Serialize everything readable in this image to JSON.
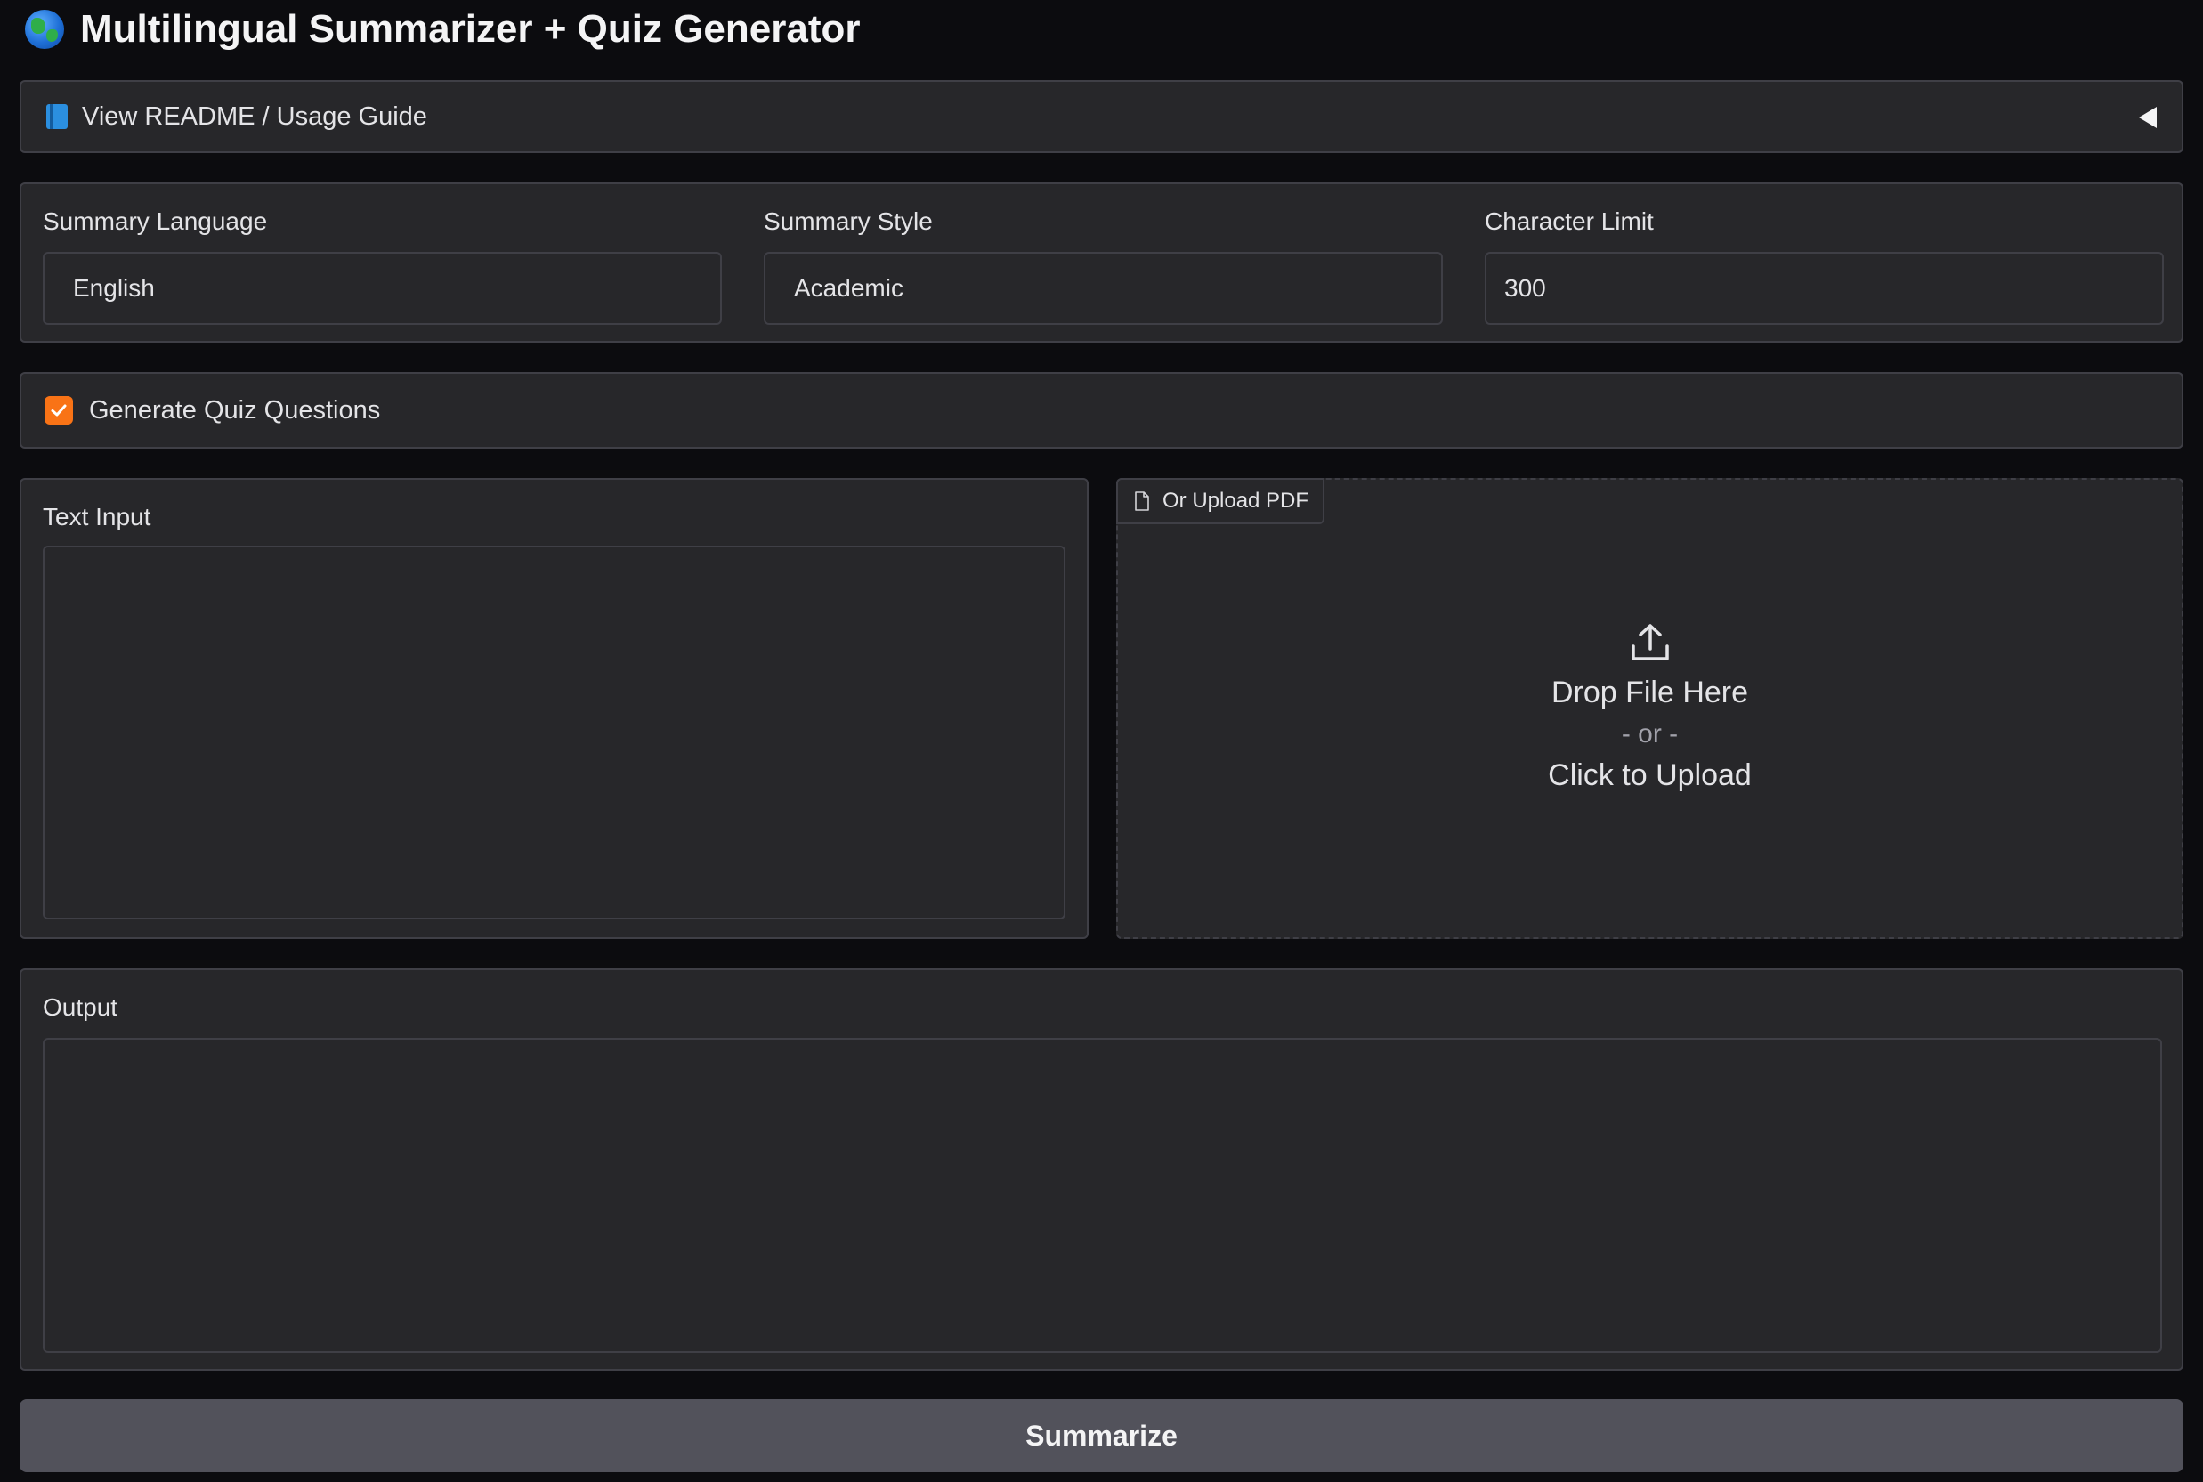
{
  "app": {
    "title": "Multilingual Summarizer + Quiz Generator",
    "title_icon": "globe-icon"
  },
  "readme": {
    "label": "View README / Usage Guide",
    "icon": "book-icon",
    "expanded": false
  },
  "settings": {
    "language": {
      "label": "Summary Language",
      "value": "English"
    },
    "style": {
      "label": "Summary Style",
      "value": "Academic"
    },
    "char_limit": {
      "label": "Character Limit",
      "value": "300"
    }
  },
  "quiz": {
    "label": "Generate Quiz Questions",
    "checked": true
  },
  "text_input": {
    "label": "Text Input",
    "value": ""
  },
  "upload": {
    "tab_label": "Or Upload PDF",
    "drop_text": "Drop File Here",
    "or_text": "- or -",
    "click_text": "Click to Upload"
  },
  "output": {
    "label": "Output",
    "value": ""
  },
  "actions": {
    "summarize_label": "Summarize"
  },
  "colors": {
    "background": "#0c0c0f",
    "panel": "#27272a",
    "border": "#3f3f46",
    "accent": "#f97316",
    "button": "#52525b"
  }
}
